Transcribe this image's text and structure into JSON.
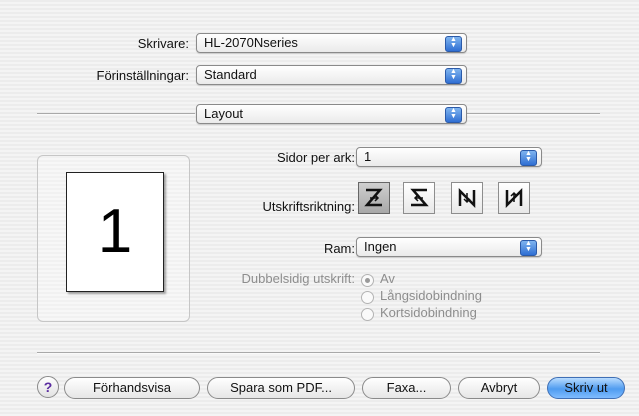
{
  "printer": {
    "label": "Skrivare:",
    "value": "HL-2070Nseries"
  },
  "presets": {
    "label": "Förinställningar:",
    "value": "Standard"
  },
  "panel": {
    "value": "Layout"
  },
  "preview": {
    "page_number": "1"
  },
  "layout": {
    "pages_per_sheet_label": "Sidor per ark:",
    "pages_per_sheet_value": "1",
    "orientation_label": "Utskriftsriktning:",
    "border_label": "Ram:",
    "border_value": "Ingen",
    "duplex_label": "Dubbelsidig utskrift:",
    "duplex_options": [
      "Av",
      "Långsidobindning",
      "Kortsidobindning"
    ],
    "duplex_selected": "Av"
  },
  "buttons": {
    "help": "?",
    "preview": "Förhandsvisa",
    "save_pdf": "Spara som PDF...",
    "fax": "Faxa...",
    "cancel": "Avbryt",
    "print": "Skriv ut"
  },
  "colors": {
    "accent": "#4f9cf0",
    "disabled_text": "#8d8d8d"
  }
}
